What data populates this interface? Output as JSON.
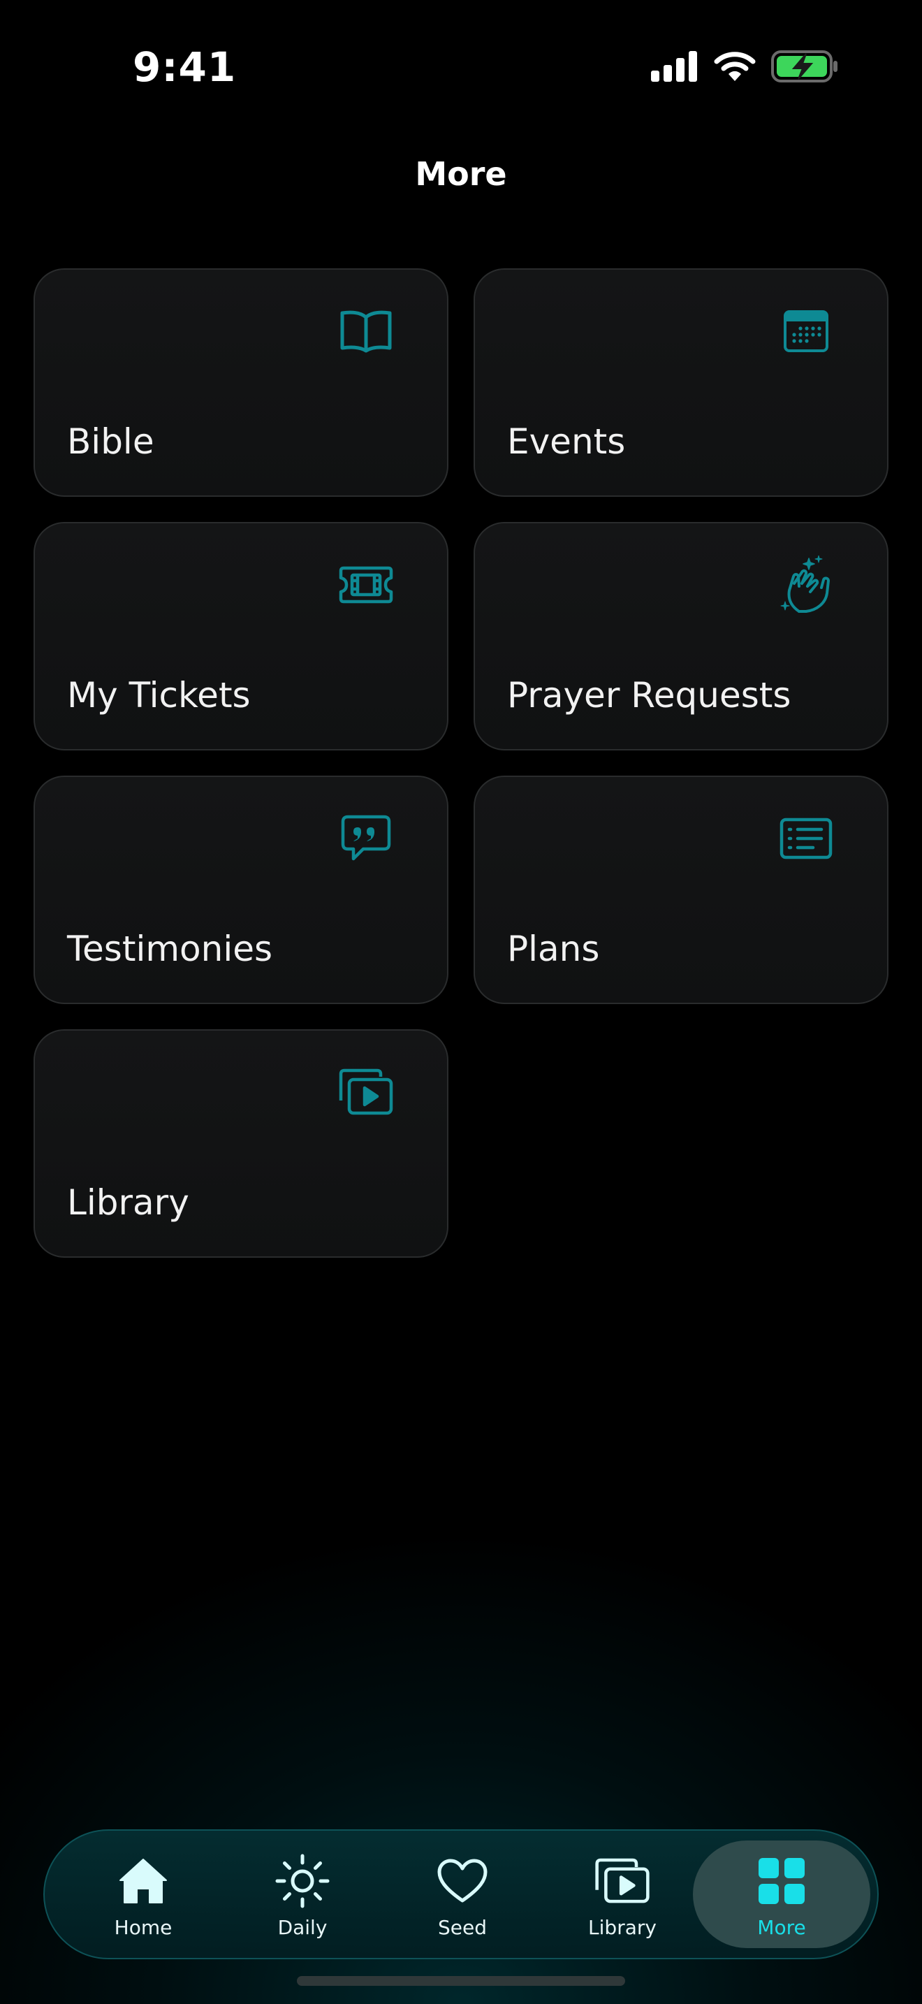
{
  "status_bar": {
    "time": "9:41",
    "icons": [
      "signal-icon",
      "wifi-icon",
      "battery-charging-icon"
    ]
  },
  "header": {
    "title": "More"
  },
  "cards": [
    {
      "label": "Bible",
      "icon": "book-icon"
    },
    {
      "label": "Events",
      "icon": "calendar-icon"
    },
    {
      "label": "My Tickets",
      "icon": "ticket-icon"
    },
    {
      "label": "Prayer Requests",
      "icon": "praying-hands-icon"
    },
    {
      "label": "Testimonies",
      "icon": "quote-bubble-icon"
    },
    {
      "label": "Plans",
      "icon": "list-icon"
    },
    {
      "label": "Library",
      "icon": "media-library-icon"
    }
  ],
  "tab_bar": {
    "items": [
      {
        "label": "Home",
        "icon": "home-icon",
        "active": false
      },
      {
        "label": "Daily",
        "icon": "sun-icon",
        "active": false
      },
      {
        "label": "Seed",
        "icon": "heart-icon",
        "active": false
      },
      {
        "label": "Library",
        "icon": "media-library-icon",
        "active": false
      },
      {
        "label": "More",
        "icon": "grid-icon",
        "active": true
      }
    ]
  },
  "colors": {
    "accent": "#19DFE8",
    "card_icon": "#0E8A94",
    "card_background": "#121314",
    "tab_bar_background": "#03282C",
    "battery_fill": "#3DD65B"
  }
}
